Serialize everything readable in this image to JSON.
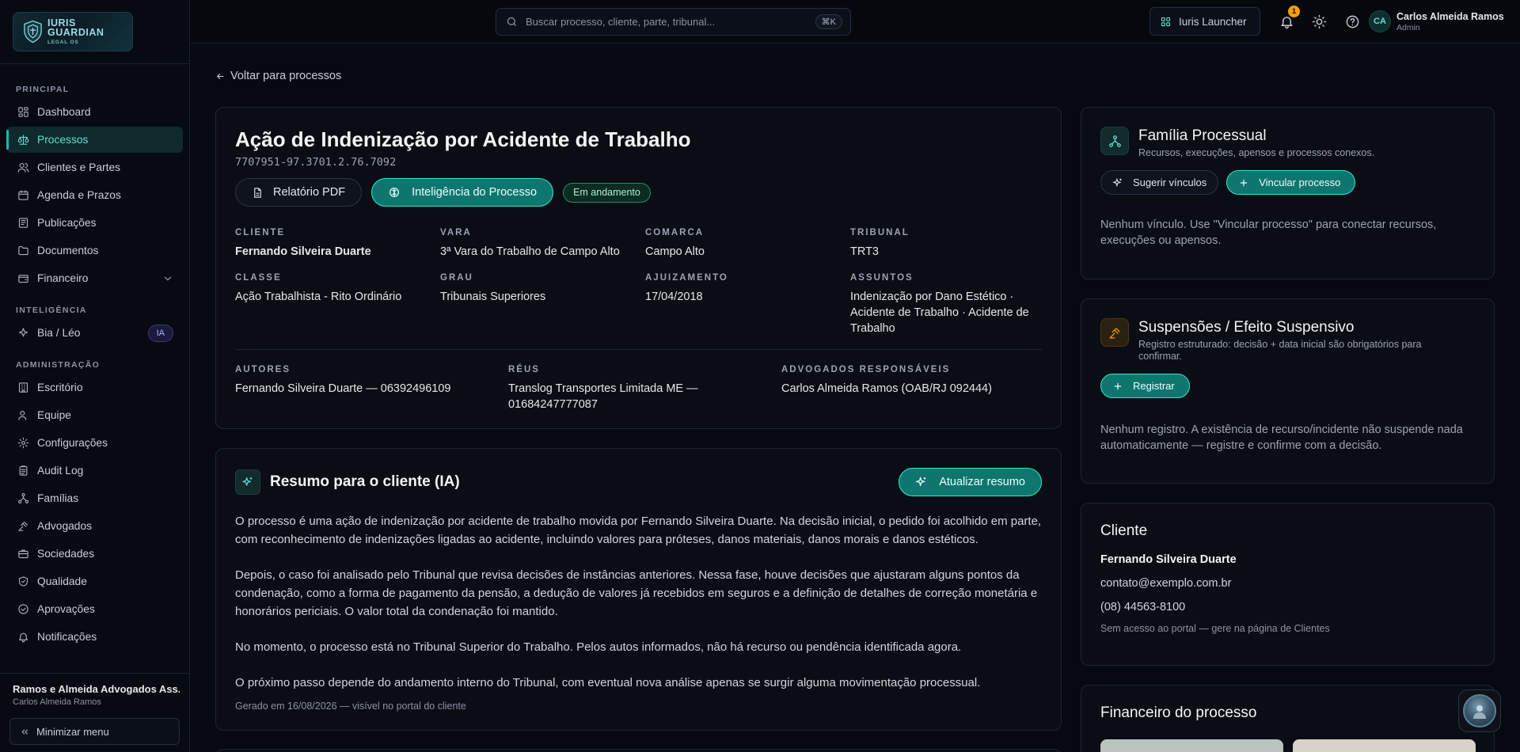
{
  "sidebar": {
    "logo_title": "IURIS GUARDIAN",
    "logo_subtitle": "LEGAL OS",
    "sections": {
      "principal": "PRINCIPAL",
      "inteligencia": "INTELIGÊNCIA",
      "administracao": "ADMINISTRAÇÃO"
    },
    "items": {
      "dashboard": "Dashboard",
      "processos": "Processos",
      "clientes": "Clientes e Partes",
      "agenda": "Agenda e Prazos",
      "publicacoes": "Publicações",
      "documentos": "Documentos",
      "financeiro": "Financeiro",
      "bia": "Bia / Léo",
      "bia_badge": "IA",
      "escritorio": "Escritório",
      "equipe": "Equipe",
      "configuracoes": "Configurações",
      "audit": "Audit Log",
      "familias": "Famílias",
      "advogados": "Advogados",
      "sociedades": "Sociedades",
      "qualidade": "Qualidade",
      "aprovacoes": "Aprovações",
      "notificacoes": "Notificações"
    },
    "firm_name": "Ramos e Almeida Advogados Ass...",
    "firm_user": "Carlos Almeida Ramos",
    "minimize_label": "Minimizar menu"
  },
  "header": {
    "search_placeholder": "Buscar processo, cliente, parte, tribunal...",
    "search_shortcut": "⌘K",
    "launcher_label": "Iuris Launcher",
    "notification_count": "1",
    "avatar_initials": "CA",
    "user_name": "Carlos Almeida Ramos",
    "user_role": "Admin"
  },
  "main": {
    "back_label": "Voltar para processos",
    "process": {
      "title": "Ação de Indenização por Acidente de Trabalho",
      "number": "7707951-97.3701.2.76.7092",
      "pdf_label": "Relatório PDF",
      "intel_label": "Inteligência do Processo",
      "status": "Em andamento",
      "fields": {
        "cliente_label": "CLIENTE",
        "cliente": "Fernando Silveira Duarte",
        "vara_label": "VARA",
        "vara": "3ª Vara do Trabalho de Campo Alto",
        "comarca_label": "COMARCA",
        "comarca": "Campo Alto",
        "tribunal_label": "TRIBUNAL",
        "tribunal": "TRT3",
        "classe_label": "CLASSE",
        "classe": "Ação Trabalhista - Rito Ordinário",
        "grau_label": "GRAU",
        "grau": "Tribunais Superiores",
        "ajuizamento_label": "AJUIZAMENTO",
        "ajuizamento": "17/04/2018",
        "assuntos_label": "ASSUNTOS",
        "assuntos": "Indenização por Dano Estético · Acidente de Trabalho · Acidente de Trabalho"
      },
      "parties": {
        "autores_label": "AUTORES",
        "autores": "Fernando Silveira Duarte — 06392496109",
        "reus_label": "RÉUS",
        "reus": "Translog Transportes Limitada ME — 01684247777087",
        "advogados_label": "ADVOGADOS RESPONSÁVEIS",
        "advogados": "Carlos Almeida Ramos (OAB/RJ 092444)"
      }
    },
    "summary": {
      "title": "Resumo para o cliente (IA)",
      "refresh_label": "Atualizar resumo",
      "paragraphs": [
        "O processo é uma ação de indenização por acidente de trabalho movida por Fernando Silveira Duarte. Na decisão inicial, o pedido foi acolhido em parte, com reconhecimento de indenizações ligadas ao acidente, incluindo valores para próteses, danos materiais, danos morais e danos estéticos.",
        "Depois, o caso foi analisado pelo Tribunal que revisa decisões de instâncias anteriores. Nessa fase, houve decisões que ajustaram alguns pontos da condenação, como a forma de pagamento da pensão, a dedução de valores já recebidos em seguros e a definição de detalhes de correção monetária e honorários periciais. O valor total da condenação foi mantido.",
        "No momento, o processo está no Tribunal Superior do Trabalho. Pelos autos informados, não há recurso ou pendência identificada agora.",
        "O próximo passo depende do andamento interno do Tribunal, com eventual nova análise apenas se surgir alguma movimentação processual."
      ],
      "footer": "Gerado em 16/08/2026 — visível no portal do cliente"
    }
  },
  "right": {
    "familia": {
      "title": "Família Processual",
      "subtitle": "Recursos, execuções, apensos e processos conexos.",
      "suggest_label": "Sugerir vínculos",
      "link_label": "Vincular processo",
      "empty": "Nenhum vínculo. Use \"Vincular processo\" para conectar recursos, execuções ou apensos."
    },
    "suspensoes": {
      "title": "Suspensões / Efeito Suspensivo",
      "subtitle": "Registro estruturado: decisão + data inicial são obrigatórios para confirmar.",
      "register_label": "Registrar",
      "empty": "Nenhum registro. A existência de recurso/incidente não suspende nada automaticamente — registre e confirme com a decisão."
    },
    "cliente": {
      "title": "Cliente",
      "name": "Fernando Silveira Duarte",
      "email": "contato@exemplo.com.br",
      "phone": "(08) 44563-8100",
      "note": "Sem acesso ao portal — gere na página de Clientes"
    },
    "financeiro": {
      "title": "Financeiro do processo"
    }
  },
  "colors": {
    "accent": "#14b8a6",
    "accent_dark": "#0f766e",
    "badge_amber": "#f59e0b",
    "status_green": "#1e8f68"
  }
}
